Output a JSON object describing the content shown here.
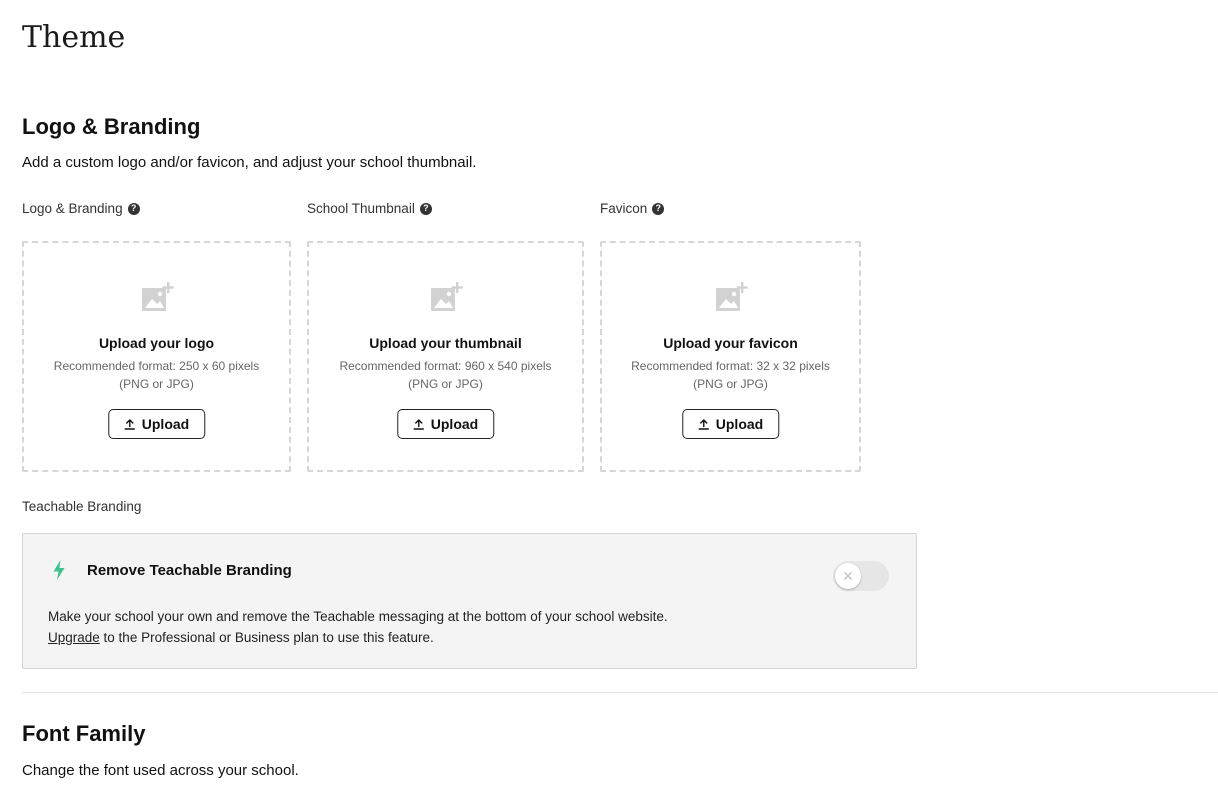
{
  "page": {
    "title": "Theme"
  },
  "logo_branding": {
    "heading": "Logo & Branding",
    "description": "Add a custom logo and/or favicon, and adjust your school thumbnail.",
    "uploads": [
      {
        "label": "Logo & Branding",
        "title": "Upload your logo",
        "format": "Recommended format: 250 x 60 pixels",
        "types": "(PNG or JPG)",
        "button": "Upload"
      },
      {
        "label": "School Thumbnail",
        "title": "Upload your thumbnail",
        "format": "Recommended format: 960 x 540 pixels",
        "types": "(PNG or JPG)",
        "button": "Upload"
      },
      {
        "label": "Favicon",
        "title": "Upload your favicon",
        "format": "Recommended format: 32 x 32 pixels",
        "types": "(PNG or JPG)",
        "button": "Upload"
      }
    ]
  },
  "teachable_branding": {
    "label": "Teachable Branding",
    "card_title": "Remove Teachable Branding",
    "toggle_on": false,
    "description": "Make your school your own and remove the Teachable messaging at the bottom of your school website.",
    "upgrade_link": "Upgrade",
    "upgrade_suffix": " to the Professional or Business plan to use this feature.",
    "accent_color": "#3ec28f"
  },
  "font_family": {
    "heading": "Font Family",
    "description": "Change the font used across your school."
  }
}
